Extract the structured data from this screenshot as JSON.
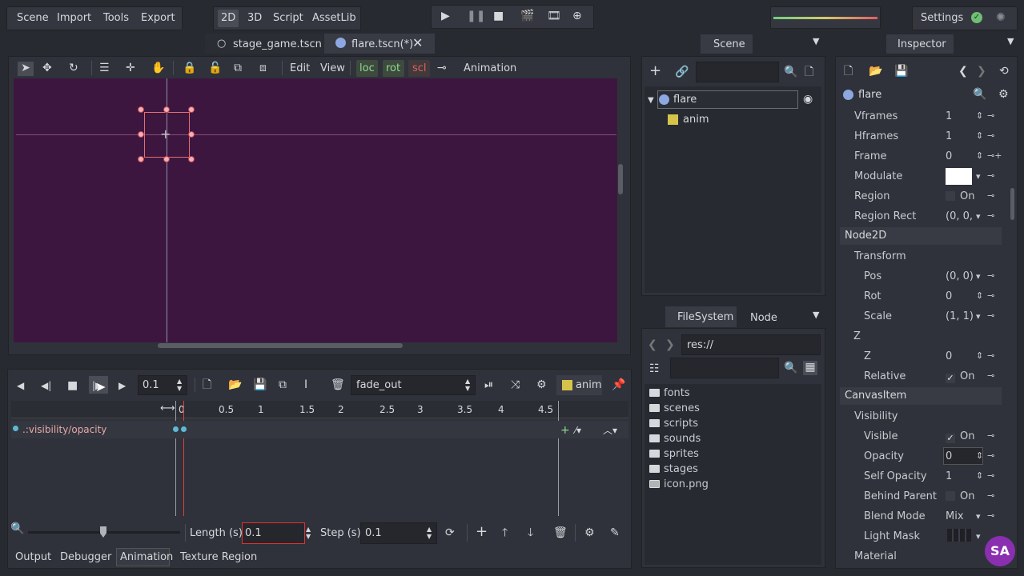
{
  "menu": {
    "scene": "Scene",
    "import": "Import",
    "tools": "Tools",
    "export": "Export"
  },
  "modes": {
    "twod": "2D",
    "threed": "3D",
    "script": "Script",
    "assetlib": "AssetLib"
  },
  "settings_label": "Settings",
  "tabs": [
    {
      "label": "stage_game.tscn"
    },
    {
      "label": "flare.tscn(*)"
    }
  ],
  "scene_dock": {
    "title": "Scene",
    "root_node": "flare",
    "child_node": "anim"
  },
  "filesystem": {
    "tab_label": "FileSystem",
    "node_tab": "Node",
    "path": "res://",
    "items": [
      "fonts",
      "scenes",
      "scripts",
      "sounds",
      "sprites",
      "stages",
      "icon.png"
    ]
  },
  "viewport_toolbar": {
    "edit": "Edit",
    "view": "View",
    "loc": "loc",
    "rot": "rot",
    "scl": "scl",
    "animation": "Animation"
  },
  "anim_panel": {
    "time": "0.1",
    "animation_name": "fade_out",
    "anim_node": "anim",
    "track": ".:visibility/opacity",
    "ruler": [
      "0",
      "0.5",
      "1",
      "1.5",
      "2",
      "2.5",
      "3",
      "3.5",
      "4",
      "4.5"
    ],
    "length_label": "Length (s):",
    "length_value": "0.1",
    "step_label": "Step (s):",
    "step_value": "0.1"
  },
  "bottom_tabs": [
    "Output",
    "Debugger",
    "Animation",
    "Texture Region"
  ],
  "inspector": {
    "title": "Inspector",
    "node": "flare",
    "props_top": [
      {
        "label": "Vframes",
        "value": "1"
      },
      {
        "label": "Hframes",
        "value": "1"
      },
      {
        "label": "Frame",
        "value": "0"
      },
      {
        "label": "Modulate",
        "value": ""
      },
      {
        "label": "Region",
        "value": "On"
      },
      {
        "label": "Region Rect",
        "value": "(0, 0,"
      }
    ],
    "node2d": "Node2D",
    "transform": "Transform",
    "pos": {
      "label": "Pos",
      "value": "(0, 0)"
    },
    "rot": {
      "label": "Rot",
      "value": "0"
    },
    "scale": {
      "label": "Scale",
      "value": "(1, 1)"
    },
    "z_section": "Z",
    "z": {
      "label": "Z",
      "value": "0"
    },
    "relative": {
      "label": "Relative",
      "value": "On"
    },
    "canvasitem": "CanvasItem",
    "visibility": "Visibility",
    "visible": {
      "label": "Visible",
      "value": "On"
    },
    "opacity": {
      "label": "Opacity",
      "value": "0"
    },
    "self_opacity": {
      "label": "Self Opacity",
      "value": "1"
    },
    "behind_parent": {
      "label": "Behind Parent",
      "value": "On"
    },
    "blend_mode": {
      "label": "Blend Mode",
      "value": "Mix"
    },
    "light_mask": {
      "label": "Light Mask"
    },
    "material": "Material"
  },
  "colors": {
    "viewport_bg": "#3d1640",
    "accent_green": "#8fd98f",
    "accent_red": "#e06060",
    "keyframe": "#5fb8d6"
  }
}
